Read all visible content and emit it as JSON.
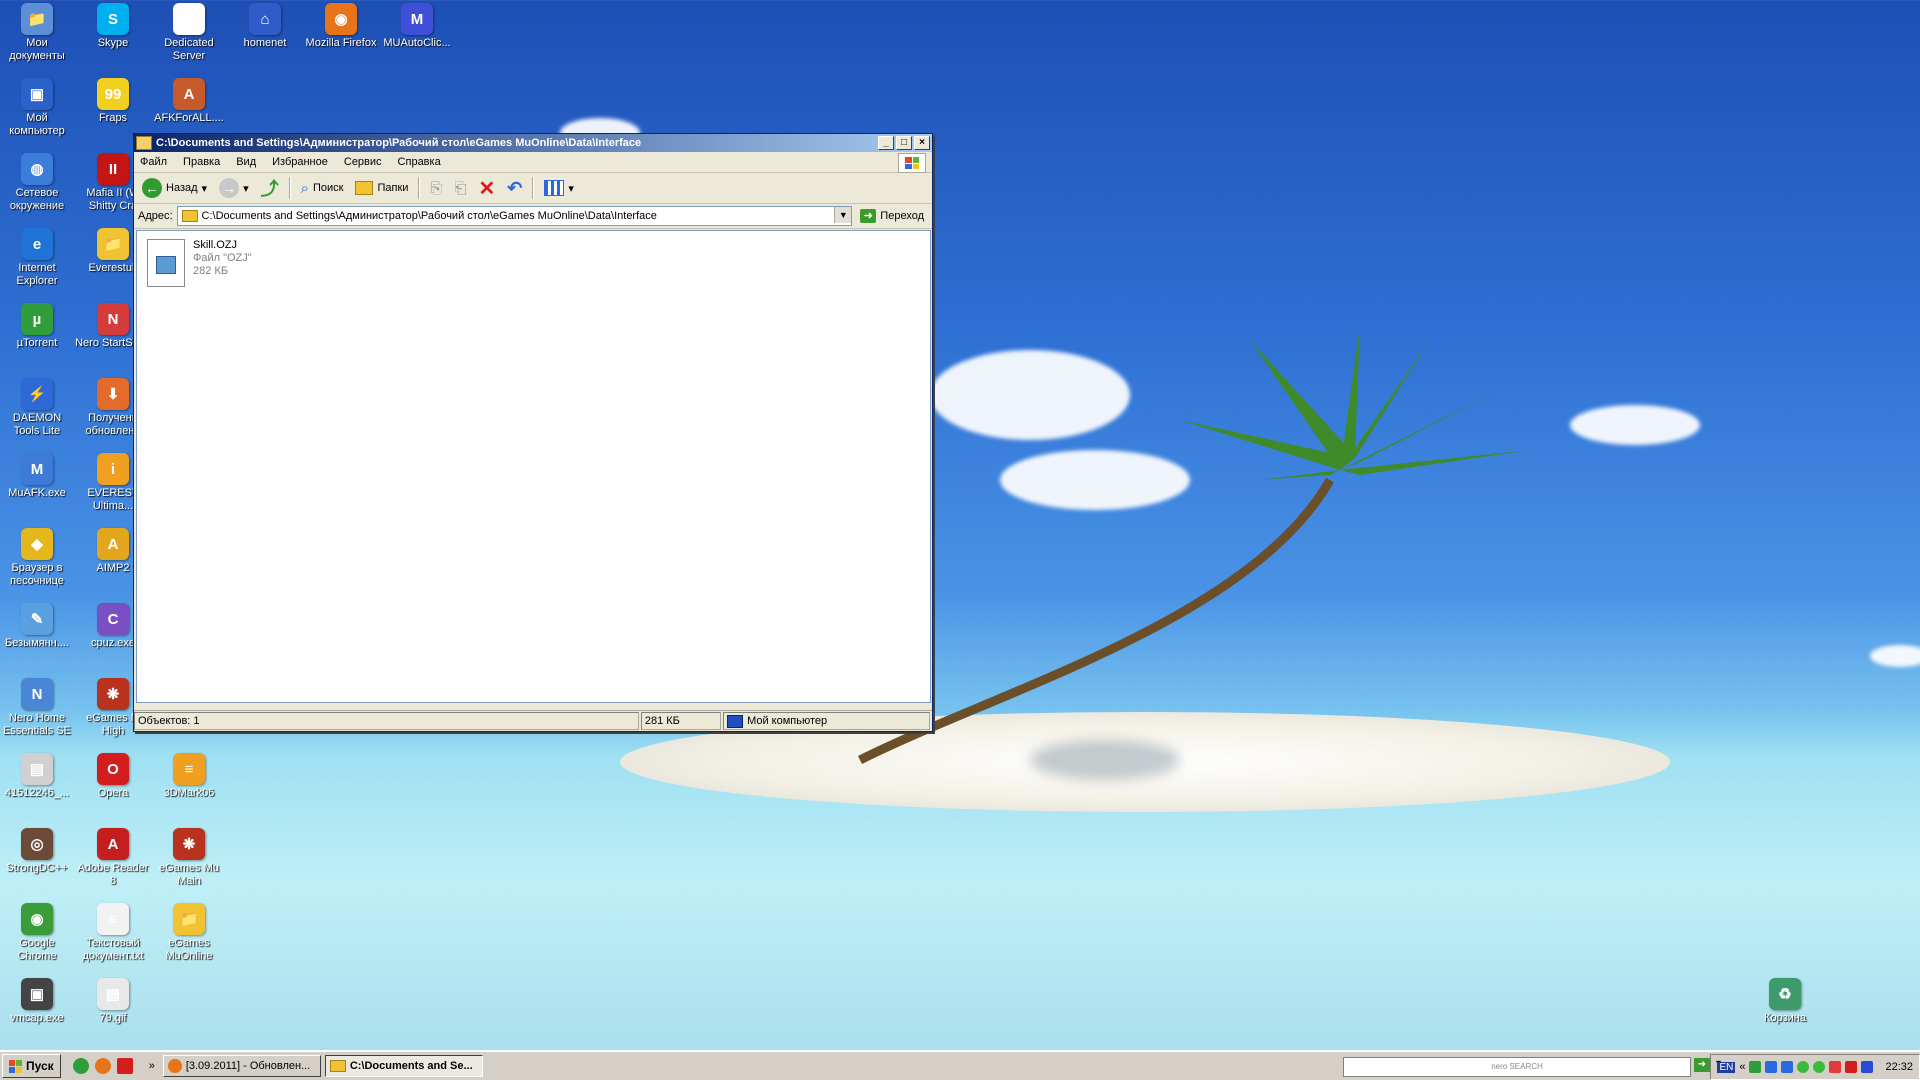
{
  "desktop": {
    "icons": [
      {
        "label": "Мои документы",
        "color": "#5c8fd6",
        "glyph": "📁"
      },
      {
        "label": "Skype",
        "color": "#00aff0",
        "glyph": "S"
      },
      {
        "label": "Dedicated Server",
        "color": "#ffffff",
        "glyph": "▭"
      },
      {
        "label": "homenet",
        "color": "#2f5cc8",
        "glyph": "⌂"
      },
      {
        "label": "Mozilla Firefox",
        "color": "#e8741a",
        "glyph": "◉"
      },
      {
        "label": "MUAutoClic...",
        "color": "#3f4fd8",
        "glyph": "M"
      },
      {
        "label": "Мой компьютер",
        "color": "#2a62c9",
        "glyph": "▣"
      },
      {
        "label": "Fraps",
        "color": "#f2d020",
        "glyph": "99"
      },
      {
        "label": "AFKForALL....",
        "color": "#c65a2a",
        "glyph": "A"
      },
      {
        "label": "Сетевое окружение",
        "color": "#3b7dd8",
        "glyph": "◍"
      },
      {
        "label": "Mafia II (W Shitty Cra",
        "color": "#c41515",
        "glyph": "II"
      },
      {
        "label": "Internet Explorer",
        "color": "#1f72d6",
        "glyph": "e"
      },
      {
        "label": "Everestult",
        "color": "#f1c232",
        "glyph": "📁"
      },
      {
        "label": "µTorrent",
        "color": "#2f9e3a",
        "glyph": "µ"
      },
      {
        "label": "Nero StartSm...",
        "color": "#d63b3b",
        "glyph": "N"
      },
      {
        "label": "DAEMON Tools Lite",
        "color": "#2d6ad8",
        "glyph": "⚡"
      },
      {
        "label": "Получени обновлени",
        "color": "#e46b2a",
        "glyph": "⬇"
      },
      {
        "label": "MuAFK.exe",
        "color": "#3d7bd6",
        "glyph": "M"
      },
      {
        "label": "EVEREST Ultima...",
        "color": "#f0a020",
        "glyph": "i"
      },
      {
        "label": "Браузер в песочнице",
        "color": "#e4b71c",
        "glyph": "◆"
      },
      {
        "label": "AIMP2",
        "color": "#e4a61c",
        "glyph": "A"
      },
      {
        "label": "Безымянн....",
        "color": "#5aa0e0",
        "glyph": "✎"
      },
      {
        "label": "cpuz.exe",
        "color": "#7a4fc4",
        "glyph": "C"
      },
      {
        "label": "Nero Home Essentials SE",
        "color": "#4a86d6",
        "glyph": "N"
      },
      {
        "label": "eGames M High",
        "color": "#b8321e",
        "glyph": "❋"
      },
      {
        "label": "41512246_...",
        "color": "#d0d0d0",
        "glyph": "▤"
      },
      {
        "label": "Opera",
        "color": "#d41e1e",
        "glyph": "O"
      },
      {
        "label": "3DMark06",
        "color": "#f0a020",
        "glyph": "≡"
      },
      {
        "label": "StrongDC++",
        "color": "#6b4a3a",
        "glyph": "◎"
      },
      {
        "label": "Adobe Reader 8",
        "color": "#c41e1e",
        "glyph": "A"
      },
      {
        "label": "eGames Mu Main",
        "color": "#b8321e",
        "glyph": "❋"
      },
      {
        "label": "Google Chrome",
        "color": "#3a9d3a",
        "glyph": "◉"
      },
      {
        "label": "Текстовый документ.txt",
        "color": "#f2f2f2",
        "glyph": "≡"
      },
      {
        "label": "eGames MuOnline",
        "color": "#f1c232",
        "glyph": "📁"
      },
      {
        "label": "vmcap.exe",
        "color": "#444444",
        "glyph": "▣"
      },
      {
        "label": "79.gif",
        "color": "#e8e8e8",
        "glyph": "▤"
      },
      {
        "label": "Корзина",
        "color": "#3d9a6a",
        "glyph": "♻"
      }
    ]
  },
  "window": {
    "title": "C:\\Documents and Settings\\Администратор\\Рабочий стол\\eGames MuOnline\\Data\\Interface",
    "menu": [
      "Файл",
      "Правка",
      "Вид",
      "Избранное",
      "Сервис",
      "Справка"
    ],
    "toolbar": {
      "back": "Назад",
      "search": "Поиск",
      "folders": "Папки"
    },
    "address": {
      "label": "Адрес:",
      "value": "C:\\Documents and Settings\\Администратор\\Рабочий стол\\eGames MuOnline\\Data\\Interface",
      "go": "Переход"
    },
    "file": {
      "name": "Skill.OZJ",
      "type": "Файл \"OZJ\"",
      "size": "282 КБ"
    },
    "status": {
      "objects": "Объектов: 1",
      "size": "281 КБ",
      "location": "Мой компьютер"
    }
  },
  "taskbar": {
    "start": "Пуск",
    "tasks": [
      {
        "label": "[3.09.2011] - Обновлен...",
        "active": false
      },
      {
        "label": "C:\\Documents and Se...",
        "active": true
      }
    ],
    "nero_search": "nero SEARCH",
    "lang": "EN",
    "clock": "22:32"
  }
}
